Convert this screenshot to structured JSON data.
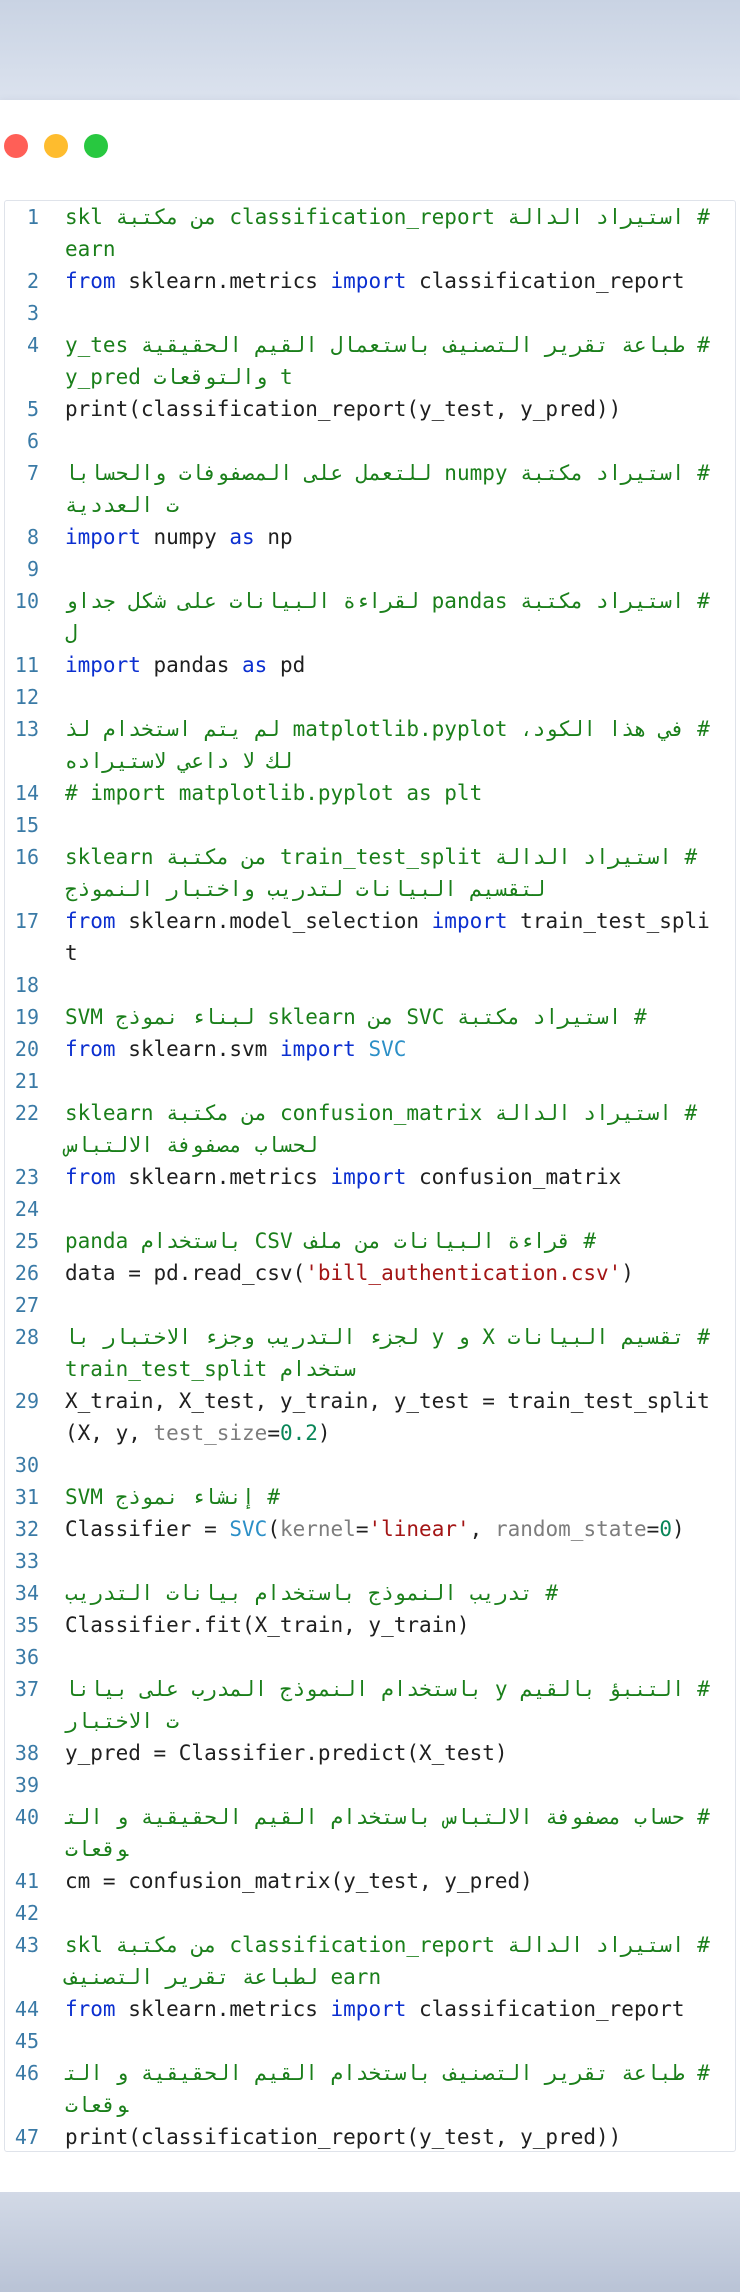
{
  "window": {
    "controls": [
      "close",
      "minimize",
      "maximize"
    ],
    "colors": {
      "close": "#ff5f57",
      "minimize": "#febc2e",
      "maximize": "#28c840"
    }
  },
  "editor": {
    "language": "python",
    "lines": [
      {
        "n": "1",
        "tokens": [
          {
            "t": "cm",
            "v": "# استيراد الدالة classification_report من مكتبة sklearn"
          }
        ]
      },
      {
        "n": "2",
        "tokens": [
          {
            "t": "kw",
            "v": "from"
          },
          {
            "t": "",
            "v": " sklearn.metrics "
          },
          {
            "t": "kw",
            "v": "import"
          },
          {
            "t": "",
            "v": " classification_report"
          }
        ]
      },
      {
        "n": "3",
        "tokens": []
      },
      {
        "n": "4",
        "tokens": [
          {
            "t": "cm",
            "v": "# طباعة تقرير التصنيف باستعمال القيم الحقيقية y_test والتوقعات y_pred"
          }
        ]
      },
      {
        "n": "5",
        "tokens": [
          {
            "t": "",
            "v": "print(classification_report(y_test, y_pred))"
          }
        ]
      },
      {
        "n": "6",
        "tokens": []
      },
      {
        "n": "7",
        "tokens": [
          {
            "t": "cm",
            "v": "# استيراد مكتبة numpy للتعمل على المصفوفات والحسابات العددية"
          }
        ]
      },
      {
        "n": "8",
        "tokens": [
          {
            "t": "kw",
            "v": "import"
          },
          {
            "t": "",
            "v": " numpy "
          },
          {
            "t": "kw",
            "v": "as"
          },
          {
            "t": "",
            "v": " np"
          }
        ]
      },
      {
        "n": "9",
        "tokens": []
      },
      {
        "n": "10",
        "tokens": [
          {
            "t": "cm",
            "v": "# استيراد مكتبة pandas لقراءة البيانات على شكل جداول"
          }
        ]
      },
      {
        "n": "11",
        "tokens": [
          {
            "t": "kw",
            "v": "import"
          },
          {
            "t": "",
            "v": " pandas "
          },
          {
            "t": "kw",
            "v": "as"
          },
          {
            "t": "",
            "v": " pd"
          }
        ]
      },
      {
        "n": "12",
        "tokens": []
      },
      {
        "n": "13",
        "tokens": [
          {
            "t": "cm",
            "v": "# في هذا الكود، matplotlib.pyplot لم يتم استخدام لذلك لا داعي لاستيراده"
          }
        ]
      },
      {
        "n": "14",
        "tokens": [
          {
            "t": "cm",
            "v": "# import matplotlib.pyplot as plt"
          }
        ]
      },
      {
        "n": "15",
        "tokens": []
      },
      {
        "n": "16",
        "tokens": [
          {
            "t": "cm",
            "v": "# استيراد الدالة train_test_split من مكتبة sklearn لتقسيم البيانات لتدريب واختبار النموذج"
          }
        ]
      },
      {
        "n": "17",
        "tokens": [
          {
            "t": "kw",
            "v": "from"
          },
          {
            "t": "",
            "v": " sklearn.model_selection "
          },
          {
            "t": "kw",
            "v": "import"
          },
          {
            "t": "",
            "v": " train_test_split"
          }
        ]
      },
      {
        "n": "18",
        "tokens": []
      },
      {
        "n": "19",
        "tokens": [
          {
            "t": "cm",
            "v": "# استيراد مكتبة SVC من sklearn لبناء نموذج SVM"
          }
        ]
      },
      {
        "n": "20",
        "tokens": [
          {
            "t": "kw",
            "v": "from"
          },
          {
            "t": "",
            "v": " sklearn.svm "
          },
          {
            "t": "kw",
            "v": "import"
          },
          {
            "t": "",
            "v": " "
          },
          {
            "t": "fn",
            "v": "SVC"
          }
        ]
      },
      {
        "n": "21",
        "tokens": []
      },
      {
        "n": "22",
        "tokens": [
          {
            "t": "cm",
            "v": "# استيراد الدالة confusion_matrix من مكتبة sklearn لحساب مصفوفة الالتباس"
          }
        ]
      },
      {
        "n": "23",
        "tokens": [
          {
            "t": "kw",
            "v": "from"
          },
          {
            "t": "",
            "v": " sklearn.metrics "
          },
          {
            "t": "kw",
            "v": "import"
          },
          {
            "t": "",
            "v": " confusion_matrix"
          }
        ]
      },
      {
        "n": "24",
        "tokens": []
      },
      {
        "n": "25",
        "tokens": [
          {
            "t": "cm",
            "v": "# قراءة البيانات من ملف CSV باستخدام panda"
          }
        ]
      },
      {
        "n": "26",
        "tokens": [
          {
            "t": "",
            "v": "data = pd.read_csv("
          },
          {
            "t": "str",
            "v": "'bill_authentication.csv'"
          },
          {
            "t": "",
            "v": ")"
          }
        ]
      },
      {
        "n": "27",
        "tokens": []
      },
      {
        "n": "28",
        "tokens": [
          {
            "t": "cm",
            "v": "# تقسيم البيانات X و y لجزء التدريب وجزء الاختبار باستخدام train_test_split"
          }
        ]
      },
      {
        "n": "29",
        "tokens": [
          {
            "t": "",
            "v": "X_train, X_test, y_train, y_test = train_test_split(X, y, "
          },
          {
            "t": "param",
            "v": "test_size"
          },
          {
            "t": "",
            "v": "="
          },
          {
            "t": "num",
            "v": "0.2"
          },
          {
            "t": "",
            "v": ")"
          }
        ]
      },
      {
        "n": "30",
        "tokens": []
      },
      {
        "n": "31",
        "tokens": [
          {
            "t": "cm",
            "v": "# إنشاء نموذج SVM"
          }
        ]
      },
      {
        "n": "32",
        "tokens": [
          {
            "t": "",
            "v": "Classifier = "
          },
          {
            "t": "fn",
            "v": "SVC"
          },
          {
            "t": "",
            "v": "("
          },
          {
            "t": "param",
            "v": "kernel"
          },
          {
            "t": "",
            "v": "="
          },
          {
            "t": "str",
            "v": "'linear'"
          },
          {
            "t": "",
            "v": ", "
          },
          {
            "t": "param",
            "v": "random_state"
          },
          {
            "t": "",
            "v": "="
          },
          {
            "t": "num",
            "v": "0"
          },
          {
            "t": "",
            "v": ")"
          }
        ]
      },
      {
        "n": "33",
        "tokens": []
      },
      {
        "n": "34",
        "tokens": [
          {
            "t": "cm",
            "v": "# تدريب النموذج باستخدام بيانات التدريب"
          }
        ]
      },
      {
        "n": "35",
        "tokens": [
          {
            "t": "",
            "v": "Classifier.fit(X_train, y_train)"
          }
        ]
      },
      {
        "n": "36",
        "tokens": []
      },
      {
        "n": "37",
        "tokens": [
          {
            "t": "cm",
            "v": "# التنبؤ بالقيم y باستخدام النموذج المدرب على بيانات الاختبار"
          }
        ]
      },
      {
        "n": "38",
        "tokens": [
          {
            "t": "",
            "v": "y_pred = Classifier.predict(X_test)"
          }
        ]
      },
      {
        "n": "39",
        "tokens": []
      },
      {
        "n": "40",
        "tokens": [
          {
            "t": "cm",
            "v": "# حساب مصفوفة الالتباس باستخدام القيم الحقيقية و التوقعات"
          }
        ]
      },
      {
        "n": "41",
        "tokens": [
          {
            "t": "",
            "v": "cm = confusion_matrix(y_test, y_pred)"
          }
        ]
      },
      {
        "n": "42",
        "tokens": []
      },
      {
        "n": "43",
        "tokens": [
          {
            "t": "cm",
            "v": "# استيراد الدالة classification_report من مكتبة sklearn لطباعة تقرير التصنيف"
          }
        ]
      },
      {
        "n": "44",
        "tokens": [
          {
            "t": "kw",
            "v": "from"
          },
          {
            "t": "",
            "v": " sklearn.metrics "
          },
          {
            "t": "kw",
            "v": "import"
          },
          {
            "t": "",
            "v": " classification_report"
          }
        ]
      },
      {
        "n": "45",
        "tokens": []
      },
      {
        "n": "46",
        "tokens": [
          {
            "t": "cm",
            "v": "# طباعة تقرير التصنيف باستخدام القيم الحقيقية و التوقعات"
          }
        ]
      },
      {
        "n": "47",
        "tokens": [
          {
            "t": "",
            "v": "print(classification_report(y_test, y_pred))"
          }
        ]
      }
    ]
  }
}
